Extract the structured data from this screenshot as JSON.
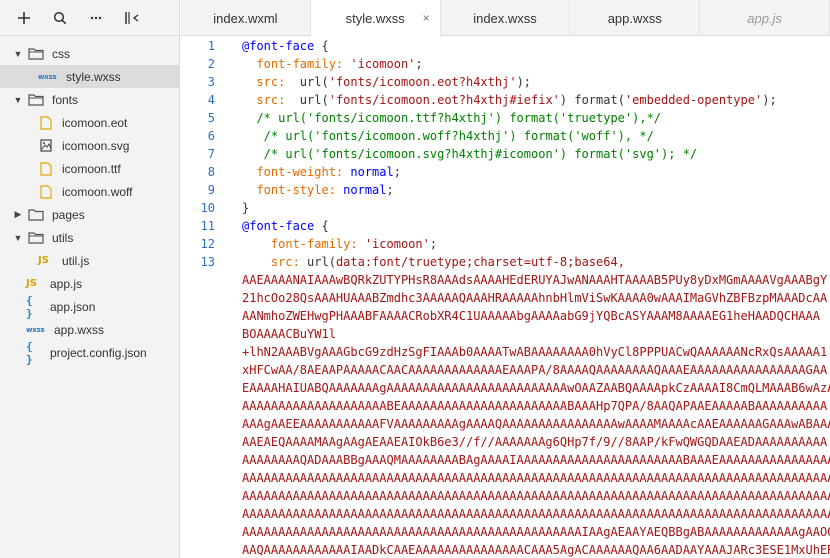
{
  "toolbar": {
    "add_icon": "+",
    "search_icon": "search",
    "more_icon": "···",
    "collapse_icon": "sidebar-toggle"
  },
  "tree": {
    "css_folder": "css",
    "style_file": "style.wxss",
    "wxss_tag": "wxss",
    "fonts_folder": "fonts",
    "font_eot": "icomoon.eot",
    "font_svg": "icomoon.svg",
    "font_ttf": "icomoon.ttf",
    "font_woff": "icomoon.woff",
    "pages_folder": "pages",
    "utils_folder": "utils",
    "util_js": "util.js",
    "js_tag": "JS",
    "app_js": "app.js",
    "app_json": "app.json",
    "app_wxss": "app.wxss",
    "project_config": "project.config.json",
    "brace_tag": "{ }"
  },
  "tabs": [
    {
      "label": "index.wxml"
    },
    {
      "label": "style.wxss"
    },
    {
      "label": "index.wxss"
    },
    {
      "label": "app.wxss"
    },
    {
      "label": "app.js"
    }
  ],
  "tab_close": "×",
  "editor": {
    "line_numbers": [
      "1",
      "2",
      "3",
      "4",
      "5",
      "6",
      "7",
      "8",
      "9",
      "10",
      "11",
      "12",
      "13"
    ],
    "l1_kw": "@font-face",
    "l1_rest": " {",
    "l2_indent": "  ",
    "l2_prop": "font-family:",
    "l2_val": " 'icomoon'",
    "l2_end": ";",
    "l3_prop": "src:",
    "l3_fn": "  url(",
    "l3_val": "'fonts/icomoon.eot?h4xthj'",
    "l3_end": ");",
    "l4_prop": "src:",
    "l4_fn": "  url(",
    "l4_val": "'fonts/icomoon.eot?h4xthj#iefix'",
    "l4_mid": ") ",
    "l4_fmt": "format(",
    "l4_fmtval": "'embedded-opentype'",
    "l4_end": ");",
    "l5": "/* url('fonts/icomoon.ttf?h4xthj') format('truetype'),*/",
    "l6": " /* url('fonts/icomoon.woff?h4xthj') format('woff'), */",
    "l7": " /* url('fonts/icomoon.svg?h4xthj#icomoon') format('svg'); */",
    "l8_prop": "font-weight:",
    "l8_val": " normal",
    "l8_end": ";",
    "l9_prop": "font-style:",
    "l9_val": " normal",
    "l9_end": ";",
    "l10": "}",
    "l11_kw": "@font-face",
    "l11_rest": " {",
    "l12_indent": "    ",
    "l12_prop": "font-family:",
    "l12_val": " 'icomoon'",
    "l12_end": ";",
    "l13_indent": "    ",
    "l13_prop": "src:",
    "l13_fn": " url(",
    "l13_val": "data:font/truetype;charset=utf-8;base64,",
    "base64_lines": [
      "AAEAAAANAIAAAwBQRkZUTYPHsR8AAAdsAAAAHEdERUYAJwANAAAHTAAAAB5PUy8yDxMGmAAAAVgAAABgY",
      "21hcOo28QsAAAHUAAABZmdhc3AAAAAQAAAHRAAAAAhnbHlmViSwKAAAA0wAAAIMaGVhZBFBzpMAAADcAA",
      "AANmhoZWEHwgPHAAABFAAAACRobXR4C1UAAAAAbgAAAAabG9jYQBcASYAAAM8AAAAEG1heHAADQCHAAA",
      "BOAAAACBuYW1l",
      "+lhN2AAABVgAAAGbcG9zdHzSgFIAAAb0AAAATwABAAAAAAAA0hVyCl8PPPUACwQAAAAAANcRxQsAAAAA1",
      "xHFCwAA/8AEAAPAAAAACAACAAAAAAAAAAAAAEAAAPA/8AAAAQAAAAAAAAQAAAEAAAAAAAAAAAAAAAAGAA",
      "EAAAAHAIUABQAAAAAAAgAAAAAAAAAAAAAAAAAAAAAAAAAwOAAZAABQAAAApkCzAAAAI8CmQLMAAAB6wAzAQk",
      "AAAAAAAAAAAAAAAAAAAABEAAAAAAAAAAAAAAAAAAAAAAABAAAHp7QPA/8AAQAPAAEAAAAABAAAAAAAAAA",
      "AAAgAAEEAAAAAAAAAAAFVAAAAAAAAAgAAAAQAAAAAAAAAAAAAAAAwAAAAMAAAAcAAEAAAAAAGAAAwABAAAAH",
      "AAEAEQAAAAMAAgAAgAEAAEAIOkB6e3//f//AAAAAAAg6QHp7f/9//8AAP/kFwQWGQDAAEADAAAAAAAAAA",
      "AAAAAAAAQADAAABBgAAAQMAAAAAAAABAgAAAAIAAAAAAAAAAAAAAAAAAAAAAABAAAEAAAAAAAAAAAAAAAA",
      "AAAAAAAAAAAAAAAAAAAAAAAAAAAAAAAAAAAAAAAAAAAAAAAAAAAAAAAAAAAAAAAAAAAAAAAAAAAAAAAAAA",
      "AAAAAAAAAAAAAAAAAAAAAAAAAAAAAAAAAAAAAAAAAAAAAAAAAAAAAAAAAAAAAAAAAAAAAAAAAAAAAAAAAA",
      "AAAAAAAAAAAAAAAAAAAAAAAAAAAAAAAAAAAAAAAAAAAAAAAAAAAAAAAAAAAAAAAAAAAAAAAAAAAAAAAAAA",
      "AAAAAAAAAAAAAAAAAAAAAAAAAAAAAAAAAAAAAAAAAAAAAAAIAAgAEAAYAEQBBgABAAAAAAAAAAAAAgAAOQI",
      "AAQAAAAAAAAAAAAIAADkCAAEAAAAAAAAAAAAAAACAAA5AgACAAAAAAQAA6AADAAYAAAJARc3ESE1MxUhERc3"
    ]
  }
}
